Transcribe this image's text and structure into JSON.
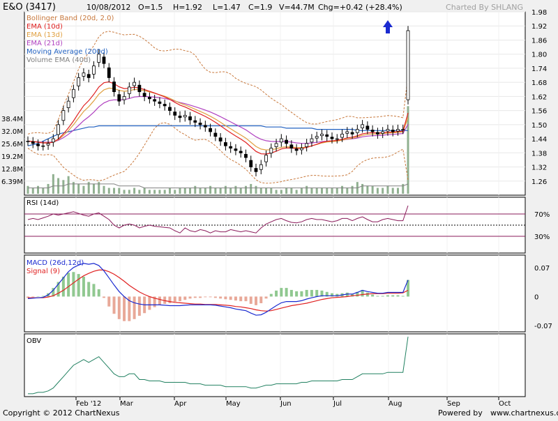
{
  "header": {
    "symbol": "E&O (3417)",
    "date": "10/08/2012",
    "open": "O=1.5",
    "high": "H=1.92",
    "low": "L=1.47",
    "close": "C=1.9",
    "volume": "V=44.7M",
    "change": "Chg=+0.42 (+28.4%)",
    "charted_by": "Charted By SHLANG"
  },
  "footer": {
    "copyright": "Copyright © 2012 ChartNexus",
    "powered_by": "Powered by",
    "site": "www.chartnexus.com"
  },
  "colors": {
    "background": "#ffffff",
    "frame": "#f0f0f0",
    "up_candle": "#ffffff",
    "down_candle": "#000000",
    "bollinger": "#c8783c",
    "ema10": "#e02020",
    "ema13": "#e0a040",
    "ema21": "#b040c0",
    "ma200": "#2060c0",
    "volume_bar": "#90b090",
    "rsi": "#8a1a5a",
    "macd": "#1a2ad0",
    "signal": "#e02020",
    "hist_pos": "#90c890",
    "hist_neg": "#e8a898",
    "obv": "#208060",
    "arrow": "#1a2ad0"
  },
  "chart_data": [
    {
      "type": "candlestick",
      "panel": "price",
      "legend": [
        {
          "label": "Bollinger Band (20d, 2.0)",
          "color": "#c8783c"
        },
        {
          "label": "EMA (10d)",
          "color": "#e02020"
        },
        {
          "label": "EMA (13d)",
          "color": "#e0a040"
        },
        {
          "label": "EMA (21d)",
          "color": "#b040c0"
        },
        {
          "label": "Moving Average (200d)",
          "color": "#2060c0"
        },
        {
          "label": "Volume EMA (40d)",
          "color": "#808080"
        }
      ],
      "price_ticks": [
        "1.98",
        "1.92",
        "1.86",
        "1.80",
        "1.74",
        "1.68",
        "1.62",
        "1.56",
        "1.50",
        "1.44",
        "1.38",
        "1.32",
        "1.26"
      ],
      "volume_ticks": [
        "38.4M",
        "32.0M",
        "25.6M",
        "19.2M",
        "12.8M",
        "6.39M"
      ],
      "x_ticks": [
        "Feb '12",
        "Mar",
        "Apr",
        "May",
        "Jun",
        "Jul",
        "Aug",
        "Sep",
        "Oct"
      ],
      "ylim": [
        1.2,
        1.98
      ],
      "volume_max": 38.4,
      "close": [
        1.43,
        1.42,
        1.41,
        1.41,
        1.42,
        1.44,
        1.5,
        1.56,
        1.6,
        1.65,
        1.7,
        1.72,
        1.7,
        1.75,
        1.8,
        1.76,
        1.7,
        1.64,
        1.6,
        1.62,
        1.66,
        1.68,
        1.64,
        1.62,
        1.61,
        1.6,
        1.59,
        1.58,
        1.56,
        1.54,
        1.53,
        1.54,
        1.52,
        1.51,
        1.5,
        1.49,
        1.47,
        1.45,
        1.43,
        1.41,
        1.4,
        1.39,
        1.38,
        1.36,
        1.32,
        1.3,
        1.33,
        1.37,
        1.4,
        1.42,
        1.44,
        1.42,
        1.4,
        1.39,
        1.4,
        1.42,
        1.44,
        1.45,
        1.46,
        1.45,
        1.44,
        1.44,
        1.46,
        1.47,
        1.46,
        1.48,
        1.5,
        1.48,
        1.47,
        1.46,
        1.47,
        1.48,
        1.47,
        1.48,
        1.48,
        1.9
      ],
      "volume": [
        4,
        3,
        4,
        3,
        5,
        10,
        8,
        7,
        9,
        6,
        5,
        4,
        6,
        5,
        6,
        4,
        3,
        3,
        3,
        2,
        2,
        3,
        2,
        3,
        2,
        2,
        2,
        2,
        3,
        2,
        3,
        3,
        3,
        4,
        3,
        3,
        4,
        3,
        3,
        4,
        3,
        4,
        3,
        4,
        5,
        4,
        3,
        3,
        3,
        2,
        2,
        3,
        3,
        2,
        3,
        4,
        3,
        3,
        3,
        3,
        3,
        3,
        4,
        3,
        4,
        6,
        5,
        4,
        4,
        3,
        3,
        4,
        3,
        3,
        5,
        44.7
      ],
      "volume_ema": [
        3,
        3,
        3,
        3,
        3,
        4,
        4,
        4,
        5,
        5,
        5,
        5,
        5,
        5,
        5,
        5,
        5,
        5,
        4,
        4,
        4,
        4,
        4,
        3,
        3,
        3,
        3,
        3,
        3,
        3,
        3,
        3,
        3,
        3,
        3,
        3,
        3,
        3,
        3,
        3,
        3,
        3,
        3,
        3,
        3,
        3,
        3,
        3,
        3,
        3,
        3,
        3,
        3,
        3,
        3,
        3,
        3,
        3,
        3,
        3,
        3,
        3,
        3,
        3,
        3,
        3,
        4,
        4,
        4,
        4,
        4,
        4,
        4,
        4,
        4,
        5
      ],
      "ma200": [
        1.41,
        1.415,
        1.42,
        1.43,
        1.44,
        1.45,
        1.46,
        1.465,
        1.47,
        1.475,
        1.48,
        1.485,
        1.49,
        1.49,
        1.495,
        1.495,
        1.495,
        1.495,
        1.495,
        1.495,
        1.495,
        1.495,
        1.495,
        1.495,
        1.495,
        1.495,
        1.495,
        1.495,
        1.495,
        1.495,
        1.495,
        1.495,
        1.495,
        1.495,
        1.495,
        1.495,
        1.495,
        1.495,
        1.495,
        1.495,
        1.495,
        1.495,
        1.495,
        1.495,
        1.495,
        1.495,
        1.495,
        1.49,
        1.49,
        1.49,
        1.49,
        1.485,
        1.485,
        1.485,
        1.485,
        1.485,
        1.485,
        1.48,
        1.48,
        1.48,
        1.48,
        1.48,
        1.48,
        1.48,
        1.48,
        1.475,
        1.475,
        1.475,
        1.475,
        1.475,
        1.475,
        1.475,
        1.475,
        1.475,
        1.475,
        1.475
      ]
    },
    {
      "type": "line",
      "panel": "rsi",
      "title": "RSI (14d)",
      "y_ticks": [
        "70%",
        "30%"
      ],
      "levels": [
        70,
        50,
        30
      ],
      "ylim": [
        0,
        100
      ],
      "values": [
        60,
        62,
        60,
        63,
        66,
        70,
        68,
        70,
        72,
        74,
        71,
        68,
        66,
        70,
        72,
        66,
        60,
        50,
        45,
        50,
        52,
        50,
        45,
        48,
        50,
        48,
        47,
        46,
        45,
        40,
        36,
        45,
        40,
        38,
        42,
        40,
        36,
        40,
        38,
        38,
        42,
        40,
        38,
        40,
        38,
        36,
        45,
        52,
        56,
        60,
        62,
        58,
        55,
        54,
        56,
        60,
        62,
        60,
        60,
        58,
        56,
        58,
        62,
        62,
        58,
        62,
        65,
        60,
        56,
        56,
        60,
        62,
        60,
        58,
        58,
        85
      ]
    },
    {
      "type": "line",
      "panel": "macd",
      "series_labels": [
        "MACD (26d,12d)",
        "Signal (9)"
      ],
      "y_ticks": [
        "0.07",
        "0",
        "-0.07"
      ],
      "ylim": [
        -0.085,
        0.1
      ],
      "macd": [
        -0.005,
        -0.004,
        -0.003,
        -0.002,
        0.004,
        0.015,
        0.03,
        0.045,
        0.06,
        0.07,
        0.076,
        0.08,
        0.078,
        0.08,
        0.075,
        0.062,
        0.045,
        0.028,
        0.012,
        0.0,
        -0.01,
        -0.015,
        -0.018,
        -0.02,
        -0.02,
        -0.02,
        -0.02,
        -0.021,
        -0.022,
        -0.022,
        -0.022,
        -0.021,
        -0.02,
        -0.02,
        -0.02,
        -0.02,
        -0.02,
        -0.021,
        -0.023,
        -0.025,
        -0.027,
        -0.03,
        -0.032,
        -0.034,
        -0.04,
        -0.045,
        -0.044,
        -0.038,
        -0.03,
        -0.022,
        -0.015,
        -0.012,
        -0.012,
        -0.012,
        -0.01,
        -0.006,
        -0.003,
        0.0,
        0.002,
        0.002,
        0.002,
        0.002,
        0.004,
        0.006,
        0.006,
        0.01,
        0.015,
        0.012,
        0.01,
        0.008,
        0.008,
        0.01,
        0.01,
        0.01,
        0.01,
        0.04
      ],
      "signal": [
        -0.003,
        -0.003,
        -0.003,
        -0.003,
        -0.001,
        0.002,
        0.008,
        0.015,
        0.024,
        0.033,
        0.042,
        0.05,
        0.056,
        0.061,
        0.064,
        0.064,
        0.06,
        0.054,
        0.046,
        0.037,
        0.027,
        0.019,
        0.011,
        0.005,
        0.0,
        -0.004,
        -0.007,
        -0.01,
        -0.012,
        -0.014,
        -0.015,
        -0.016,
        -0.017,
        -0.018,
        -0.018,
        -0.019,
        -0.019,
        -0.019,
        -0.02,
        -0.021,
        -0.022,
        -0.024,
        -0.025,
        -0.027,
        -0.029,
        -0.032,
        -0.034,
        -0.035,
        -0.034,
        -0.031,
        -0.028,
        -0.025,
        -0.022,
        -0.02,
        -0.018,
        -0.016,
        -0.013,
        -0.01,
        -0.007,
        -0.005,
        -0.003,
        -0.002,
        -0.001,
        0.0,
        0.002,
        0.003,
        0.005,
        0.006,
        0.007,
        0.007,
        0.007,
        0.008,
        0.008,
        0.008,
        0.009,
        0.015
      ]
    },
    {
      "type": "line",
      "panel": "obv",
      "title": "OBV",
      "values": [
        0,
        0,
        1,
        1,
        2,
        4,
        8,
        12,
        16,
        20,
        22,
        24,
        22,
        24,
        26,
        22,
        18,
        14,
        12,
        12,
        14,
        14,
        10,
        10,
        9,
        9,
        9,
        8,
        8,
        8,
        8,
        8,
        7,
        7,
        7,
        6,
        6,
        6,
        6,
        5,
        5,
        5,
        5,
        5,
        4,
        4,
        5,
        6,
        6,
        7,
        7,
        7,
        7,
        7,
        8,
        8,
        9,
        9,
        9,
        9,
        9,
        9,
        10,
        10,
        10,
        12,
        14,
        14,
        14,
        14,
        14,
        15,
        15,
        15,
        15,
        40
      ],
      "ylim": [
        -2,
        42
      ]
    }
  ]
}
